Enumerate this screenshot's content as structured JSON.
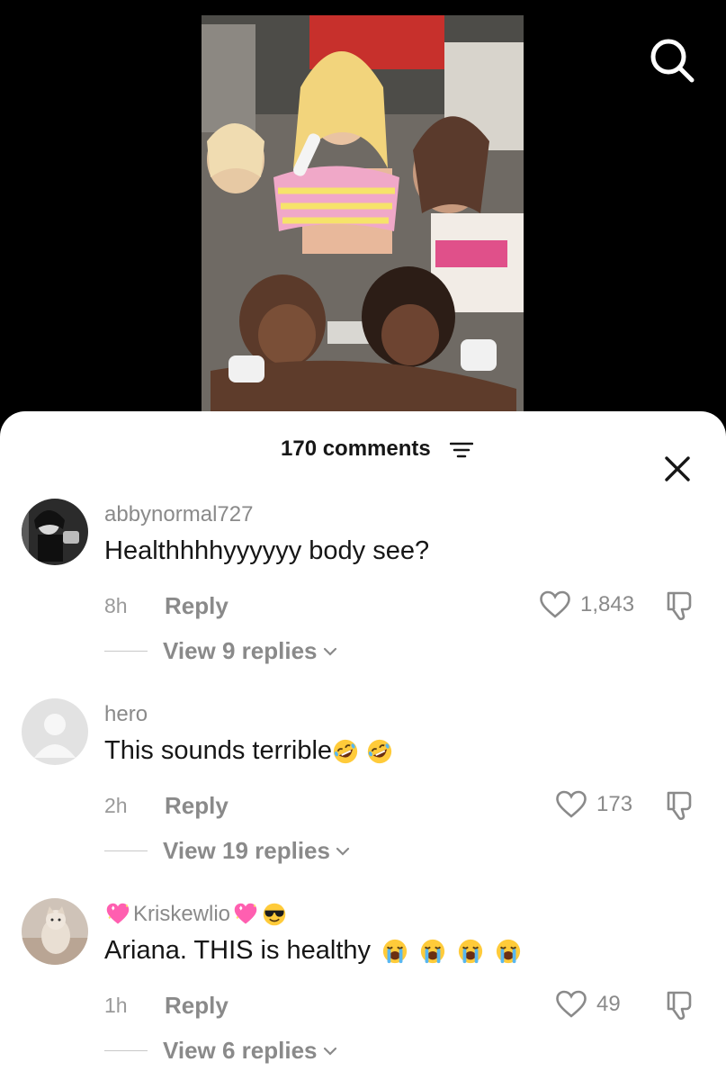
{
  "header": {
    "comment_count_label": "170 comments"
  },
  "comments": [
    {
      "username": "abbynormal727",
      "text": "Healthhhhyyyyyy body see?",
      "time": "8h",
      "reply_label": "Reply",
      "likes": "1,843",
      "view_replies": "View 9 replies",
      "avatar": "dark-photo-avatar",
      "body_emojis": []
    },
    {
      "username": "hero",
      "text": "This sounds terrible",
      "time": "2h",
      "reply_label": "Reply",
      "likes": "173",
      "view_replies": "View 19 replies",
      "avatar": "default-avatar",
      "body_emojis": [
        "rolling-on-floor-laughing",
        "rolling-on-floor-laughing"
      ]
    },
    {
      "username": "Kriskewlio",
      "username_emojis_before": [
        "sparkling-heart"
      ],
      "username_emojis_after": [
        "sparkling-heart",
        "smiling-face-with-sunglasses"
      ],
      "text": "Ariana. THIS is healthy",
      "time": "1h",
      "reply_label": "Reply",
      "likes": "49",
      "view_replies": "View 6 replies",
      "avatar": "cat-photo-avatar",
      "body_emojis": [
        "loudly-crying-face",
        "loudly-crying-face",
        "loudly-crying-face",
        "loudly-crying-face"
      ]
    }
  ],
  "icons": {
    "search": "search-icon",
    "filter": "filter-icon",
    "close": "close-icon",
    "like": "heart-outline-icon",
    "dislike": "thumbs-down-icon",
    "expand": "chevron-down-icon"
  },
  "colors": {
    "background": "#000000",
    "sheet": "#ffffff",
    "primary_text": "#161616",
    "secondary_text": "#8a8a8a"
  }
}
